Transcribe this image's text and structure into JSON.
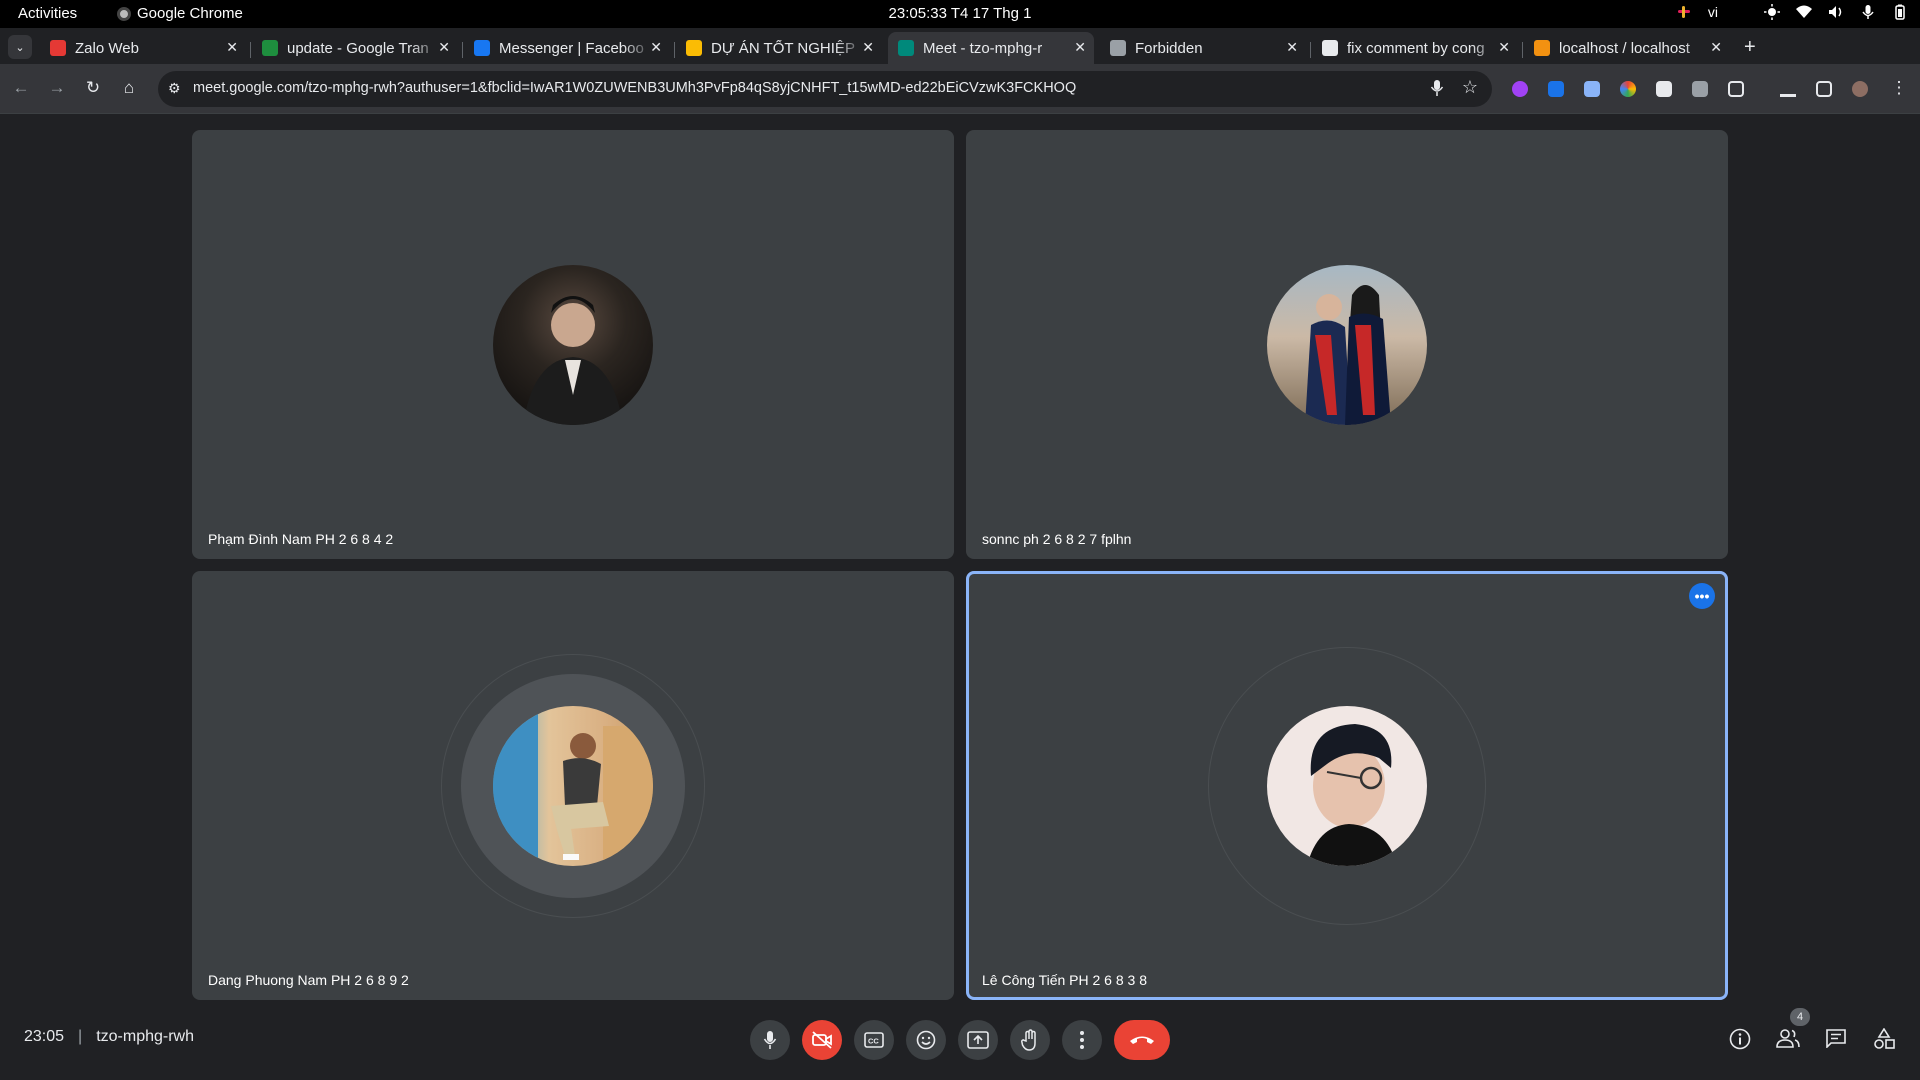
{
  "gnome": {
    "activities": "Activities",
    "app_name": "Google Chrome",
    "clock": "23:05:33  T4 17 Thg 1",
    "input_lang": "vi"
  },
  "tabs": [
    {
      "title": "Zalo Web",
      "favicon_color": "#e53935"
    },
    {
      "title": "update - Google Tran",
      "favicon_color": "#1e8e3e"
    },
    {
      "title": "Messenger | Faceboo",
      "favicon_color": "#1877f2"
    },
    {
      "title": "DỰ ÁN TỐT NGHIỆP",
      "favicon_color": "#fbbc04"
    },
    {
      "title": "Meet - tzo-mphg-r",
      "favicon_color": "#00897b",
      "active": true
    },
    {
      "title": "Forbidden",
      "favicon_color": "#9aa0a6"
    },
    {
      "title": "fix comment by cong",
      "favicon_color": "#e8eaed"
    },
    {
      "title": "localhost / localhost",
      "favicon_color": "#f29111"
    }
  ],
  "toolbar": {
    "url": "meet.google.com/tzo-mphg-rwh?authuser=1&fbclid=IwAR1W0ZUWENB3UMh3PvFp84qS8yjCNHFT_t15wMD-ed22bEiCVzwK3FCKHOQ"
  },
  "participants": [
    {
      "name": "Phạm Đình Nam PH 2 6 8 4 2"
    },
    {
      "name": "sonnc ph 2 6 8 2 7 fplhn"
    },
    {
      "name": "Dang Phuong Nam PH 2 6 8 9 2"
    },
    {
      "name": "Lê Công Tiến PH 2 6 8 3 8"
    }
  ],
  "meeting": {
    "time": "23:05",
    "separator": "|",
    "code": "tzo-mphg-rwh",
    "people_count": "4"
  },
  "colors": {
    "accent": "#1a73e8",
    "hangup": "#ea4335",
    "tile_bg": "#3c4043",
    "page_bg": "#202124"
  },
  "icons": {
    "mic": "mic-icon",
    "camera_off": "camera-off-icon",
    "captions": "captions-icon",
    "emoji": "emoji-icon",
    "present": "present-icon",
    "hand": "raise-hand-icon",
    "more": "more-vert-icon",
    "hangup": "hangup-icon",
    "info": "info-icon",
    "people": "people-icon",
    "chat": "chat-icon",
    "activities": "activities-icon"
  }
}
